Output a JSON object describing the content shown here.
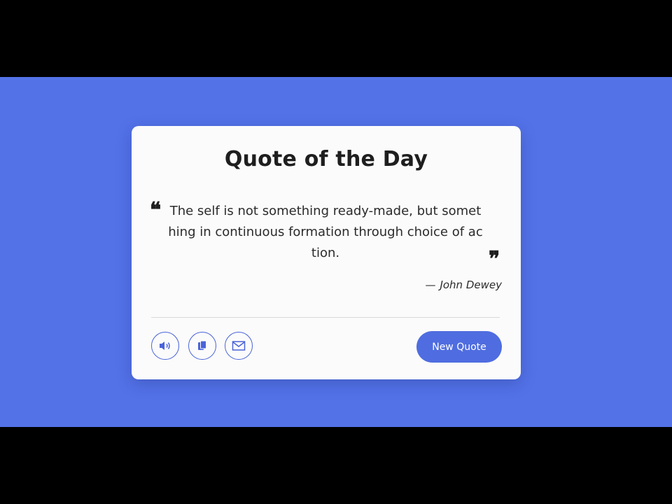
{
  "colors": {
    "background": "#5372e8",
    "card": "#fbfbfb",
    "accent": "#4f6de0",
    "letterbox": "#000000"
  },
  "card": {
    "title": "Quote of the Day",
    "quote": {
      "open_mark": "❝",
      "close_mark": "❞",
      "text": "The self is not something ready-made, but something in continuous formation through choice of action."
    },
    "author": {
      "dash": "—",
      "name": "John Dewey"
    },
    "actions": {
      "speech_icon": "speaker-icon",
      "copy_icon": "copy-icon",
      "share_icon": "mail-icon",
      "new_quote_label": "New Quote"
    }
  }
}
